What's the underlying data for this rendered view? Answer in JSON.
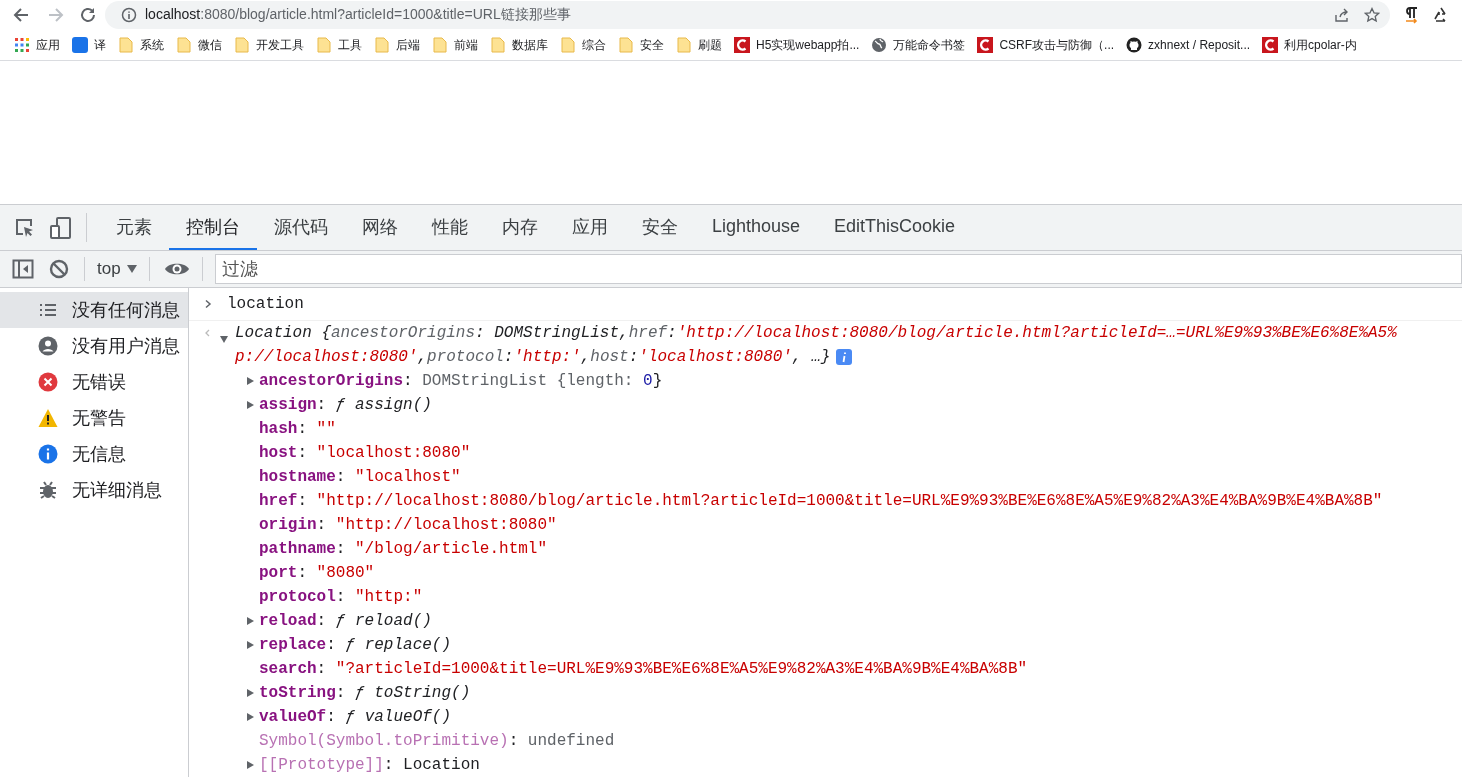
{
  "address_bar": {
    "host": "localhost",
    "path": ":8080/blog/article.html?articleId=1000&title=URL链接那些事"
  },
  "bookmarks": [
    {
      "kind": "apps",
      "label": "应用"
    },
    {
      "kind": "translate",
      "label": "译"
    },
    {
      "kind": "folder",
      "label": "系统"
    },
    {
      "kind": "folder",
      "label": "微信"
    },
    {
      "kind": "folder",
      "label": "开发工具"
    },
    {
      "kind": "folder",
      "label": "工具"
    },
    {
      "kind": "folder",
      "label": "后端"
    },
    {
      "kind": "folder",
      "label": "前端"
    },
    {
      "kind": "folder",
      "label": "数据库"
    },
    {
      "kind": "folder",
      "label": "综合"
    },
    {
      "kind": "folder",
      "label": "安全"
    },
    {
      "kind": "folder",
      "label": "刷题"
    },
    {
      "kind": "site",
      "label": "H5实现webapp拍..."
    },
    {
      "kind": "globe",
      "label": "万能命令书签"
    },
    {
      "kind": "site",
      "label": "CSRF攻击与防御（..."
    },
    {
      "kind": "github",
      "label": "zxhnext / Reposit..."
    },
    {
      "kind": "site",
      "label": "利用cpolar-内"
    }
  ],
  "devtools": {
    "tabs": [
      {
        "label": "元素",
        "selected": false
      },
      {
        "label": "控制台",
        "selected": true
      },
      {
        "label": "源代码",
        "selected": false
      },
      {
        "label": "网络",
        "selected": false
      },
      {
        "label": "性能",
        "selected": false
      },
      {
        "label": "内存",
        "selected": false
      },
      {
        "label": "应用",
        "selected": false
      },
      {
        "label": "安全",
        "selected": false
      },
      {
        "label": "Lighthouse",
        "selected": false
      },
      {
        "label": "EditThisCookie",
        "selected": false
      }
    ],
    "context": "top",
    "filter": {
      "placeholder": "过滤"
    }
  },
  "sidebar": {
    "items": [
      {
        "kind": "all",
        "label": "没有任何消息",
        "selected": true
      },
      {
        "kind": "user",
        "label": "没有用户消息",
        "selected": false
      },
      {
        "kind": "error",
        "label": "无错误",
        "selected": false
      },
      {
        "kind": "warning",
        "label": "无警告",
        "selected": false
      },
      {
        "kind": "info",
        "label": "无信息",
        "selected": false
      },
      {
        "kind": "verbose",
        "label": "无详细消息",
        "selected": false
      }
    ]
  },
  "console": {
    "input": "location",
    "summary_lines": [
      [
        {
          "kind": "plain",
          "text": "Location {"
        },
        {
          "kind": "key",
          "text": "ancestorOrigins"
        },
        {
          "kind": "plain",
          "text": ": DOMStringList, "
        },
        {
          "kind": "key",
          "text": "href"
        },
        {
          "kind": "plain",
          "text": ": "
        },
        {
          "kind": "string",
          "text": "'http://localhost:8080/blog/article.html?articleId=…=URL%E9%93%BE%E6%8E%A5%"
        }
      ],
      [
        {
          "kind": "string",
          "text": "p://localhost:8080'"
        },
        {
          "kind": "plain",
          "text": ", "
        },
        {
          "kind": "key",
          "text": "protocol"
        },
        {
          "kind": "plain",
          "text": ": "
        },
        {
          "kind": "string",
          "text": "'http:'"
        },
        {
          "kind": "plain",
          "text": ", "
        },
        {
          "kind": "key",
          "text": "host"
        },
        {
          "kind": "plain",
          "text": ": "
        },
        {
          "kind": "string",
          "text": "'localhost:8080'"
        },
        {
          "kind": "plain",
          "text": ", …}"
        }
      ]
    ],
    "expanded": true,
    "properties": [
      {
        "name": "ancestorOrigins",
        "expandable": true,
        "dim": false,
        "value": [
          {
            "kind": "plain",
            "text": ": "
          },
          {
            "kind": "gray",
            "text": "DOMStringList {length: "
          },
          {
            "kind": "number",
            "text": "0"
          },
          {
            "kind": "plain",
            "text": "}"
          }
        ]
      },
      {
        "name": "assign",
        "expandable": true,
        "dim": false,
        "value": [
          {
            "kind": "plain",
            "text": ": "
          },
          {
            "kind": "func",
            "text": "ƒ assign()"
          }
        ]
      },
      {
        "name": "hash",
        "expandable": false,
        "dim": false,
        "value": [
          {
            "kind": "plain",
            "text": ": "
          },
          {
            "kind": "string",
            "text": "\"\""
          }
        ]
      },
      {
        "name": "host",
        "expandable": false,
        "dim": false,
        "value": [
          {
            "kind": "plain",
            "text": ": "
          },
          {
            "kind": "string",
            "text": "\"localhost:8080\""
          }
        ]
      },
      {
        "name": "hostname",
        "expandable": false,
        "dim": false,
        "value": [
          {
            "kind": "plain",
            "text": ": "
          },
          {
            "kind": "string",
            "text": "\"localhost\""
          }
        ]
      },
      {
        "name": "href",
        "expandable": false,
        "dim": false,
        "value": [
          {
            "kind": "plain",
            "text": ": "
          },
          {
            "kind": "string",
            "text": "\"http://localhost:8080/blog/article.html?articleId=1000&title=URL%E9%93%BE%E6%8E%A5%E9%82%A3%E4%BA%9B%E4%BA%8B\""
          }
        ]
      },
      {
        "name": "origin",
        "expandable": false,
        "dim": false,
        "value": [
          {
            "kind": "plain",
            "text": ": "
          },
          {
            "kind": "string",
            "text": "\"http://localhost:8080\""
          }
        ]
      },
      {
        "name": "pathname",
        "expandable": false,
        "dim": false,
        "value": [
          {
            "kind": "plain",
            "text": ": "
          },
          {
            "kind": "string",
            "text": "\"/blog/article.html\""
          }
        ]
      },
      {
        "name": "port",
        "expandable": false,
        "dim": false,
        "value": [
          {
            "kind": "plain",
            "text": ": "
          },
          {
            "kind": "string",
            "text": "\"8080\""
          }
        ]
      },
      {
        "name": "protocol",
        "expandable": false,
        "dim": false,
        "value": [
          {
            "kind": "plain",
            "text": ": "
          },
          {
            "kind": "string",
            "text": "\"http:\""
          }
        ]
      },
      {
        "name": "reload",
        "expandable": true,
        "dim": false,
        "value": [
          {
            "kind": "plain",
            "text": ": "
          },
          {
            "kind": "func",
            "text": "ƒ reload()"
          }
        ]
      },
      {
        "name": "replace",
        "expandable": true,
        "dim": false,
        "value": [
          {
            "kind": "plain",
            "text": ": "
          },
          {
            "kind": "func",
            "text": "ƒ replace()"
          }
        ]
      },
      {
        "name": "search",
        "expandable": false,
        "dim": false,
        "value": [
          {
            "kind": "plain",
            "text": ": "
          },
          {
            "kind": "string",
            "text": "\"?articleId=1000&title=URL%E9%93%BE%E6%8E%A5%E9%82%A3%E4%BA%9B%E4%BA%8B\""
          }
        ]
      },
      {
        "name": "toString",
        "expandable": true,
        "dim": false,
        "value": [
          {
            "kind": "plain",
            "text": ": "
          },
          {
            "kind": "func",
            "text": "ƒ toString()"
          }
        ]
      },
      {
        "name": "valueOf",
        "expandable": true,
        "dim": false,
        "value": [
          {
            "kind": "plain",
            "text": ": "
          },
          {
            "kind": "func",
            "text": "ƒ valueOf()"
          }
        ]
      },
      {
        "name": "Symbol(Symbol.toPrimitive)",
        "expandable": false,
        "dim": true,
        "value": [
          {
            "kind": "plain",
            "text": ": "
          },
          {
            "kind": "gray",
            "text": "undefined"
          }
        ]
      },
      {
        "name": "[[Prototype]]",
        "expandable": true,
        "dim": true,
        "value": [
          {
            "kind": "plain",
            "text": ": "
          },
          {
            "kind": "plain",
            "text": "Location"
          }
        ]
      }
    ]
  }
}
